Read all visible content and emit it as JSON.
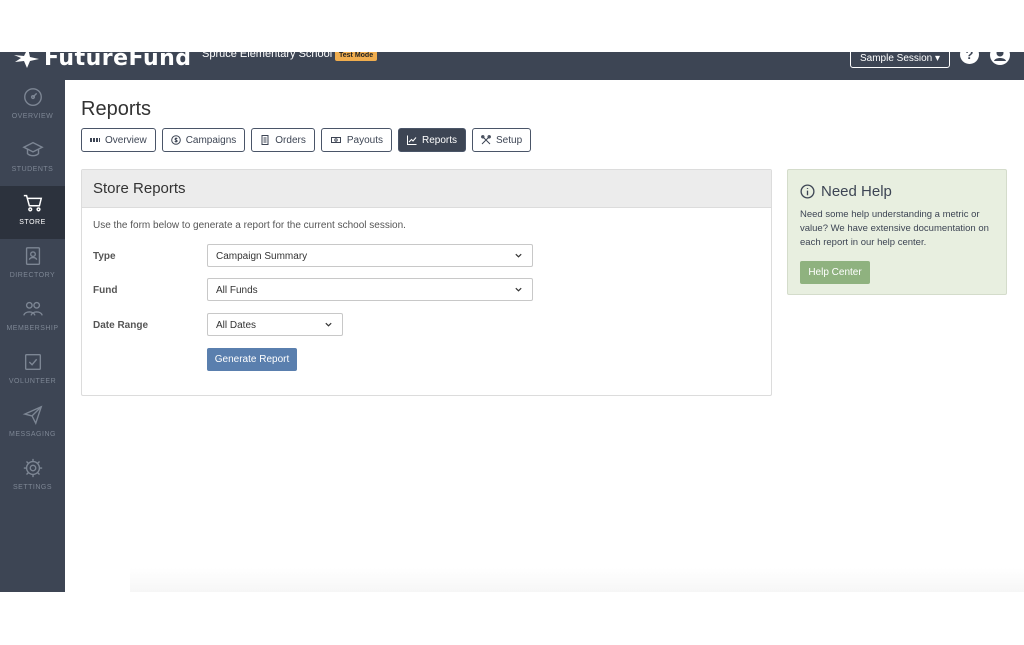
{
  "header": {
    "logo_text": "FutureFund",
    "school_name": "Spruce Elementary School",
    "test_mode_badge": "Test Mode",
    "session_button": "Sample Session ▾",
    "help_icon_glyph": "?"
  },
  "sidebar": {
    "items": [
      {
        "label": "Overview",
        "icon": "overview-icon"
      },
      {
        "label": "Students",
        "icon": "graduation-cap-icon"
      },
      {
        "label": "Store",
        "icon": "cart-icon"
      },
      {
        "label": "Directory",
        "icon": "address-book-icon"
      },
      {
        "label": "Membership",
        "icon": "people-icon"
      },
      {
        "label": "Volunteer",
        "icon": "checkbox-icon"
      },
      {
        "label": "Messaging",
        "icon": "paper-plane-icon"
      },
      {
        "label": "Settings",
        "icon": "gear-icon"
      }
    ]
  },
  "page": {
    "title": "Reports"
  },
  "tabs": [
    {
      "label": "Overview",
      "icon": "grid-icon"
    },
    {
      "label": "Campaigns",
      "icon": "dollar-icon"
    },
    {
      "label": "Orders",
      "icon": "document-icon"
    },
    {
      "label": "Payouts",
      "icon": "money-icon"
    },
    {
      "label": "Reports",
      "icon": "chart-icon"
    },
    {
      "label": "Setup",
      "icon": "tools-icon"
    }
  ],
  "store_reports": {
    "title": "Store Reports",
    "description": "Use the form below to generate a report for the current school session.",
    "type_label": "Type",
    "type_value": "Campaign Summary",
    "fund_label": "Fund",
    "fund_value": "All Funds",
    "date_label": "Date Range",
    "date_value": "All Dates",
    "generate_button": "Generate Report"
  },
  "help": {
    "title": "Need Help",
    "text": "Need some help understanding a metric or value? We have extensive documentation on each report in our help center.",
    "button": "Help Center"
  },
  "colors": {
    "nav_bg": "#3d4554",
    "primary_button": "#5a7fae",
    "help_panel_bg": "#e8efe0",
    "help_button": "#8fb27f",
    "badge": "#f0ad4e"
  }
}
